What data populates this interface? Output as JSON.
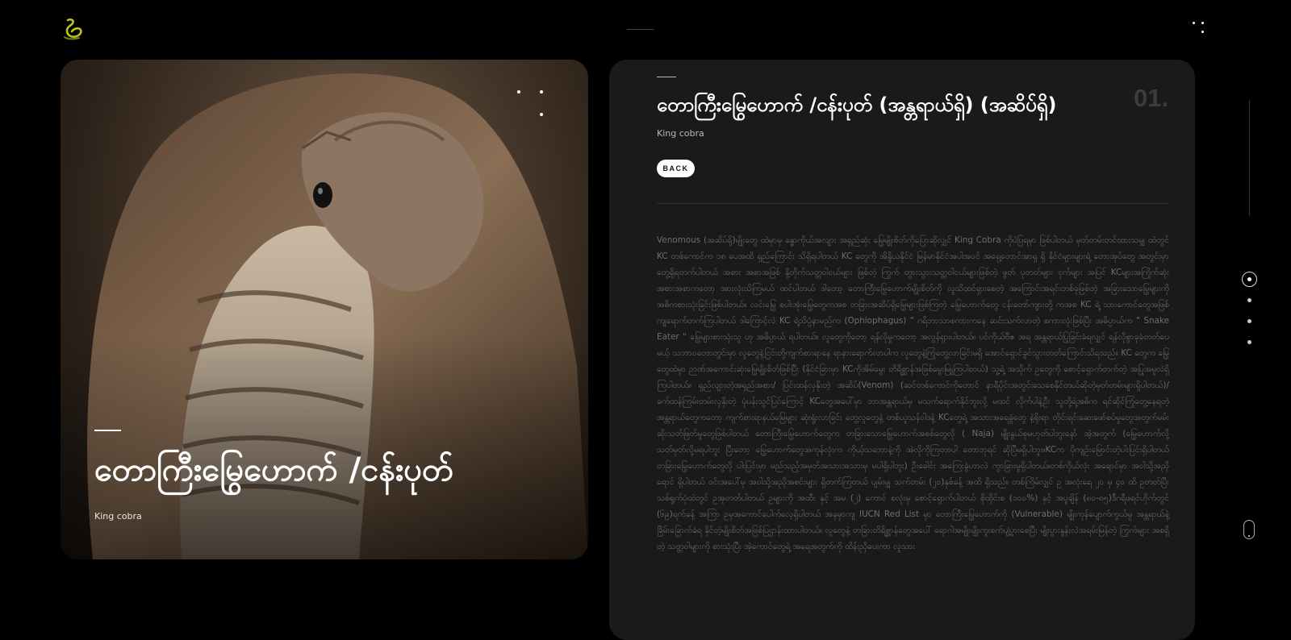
{
  "header": {
    "logo_icon": "cobra-logo-icon",
    "menu_icon": "dots-menu-icon"
  },
  "hero": {
    "title": "တောကြီးမြွေဟောက် /ငန်းပုတ်",
    "subtitle": "King cobra",
    "image": "king-cobra-photo"
  },
  "detail": {
    "title": "တောကြီးမြွေဟောက် /ငန်းပုတ် (အန္တရာယ်ရှိ) (အဆိပ်ရှိ)",
    "subtitle": "King cobra",
    "number": "01.",
    "back_label": "BACK",
    "body": "Venomous (အဆိပ်ရှိ)မျိုးတွေ ထဲမှာမှ ခန္ဓာကိုယ်အလျား အရှည်ဆုံး မြွေမျိုးစိတ်ကိုပြောဆိုလျှင် King Cobra ကိုပဲပြရမှာ ဖြစ်ပါတယ် မှတ်တမ်းတင်ထားသမျှ ထဲတွင် KC တစ်ကောင်က ၁၈ ပေအထိ ရှည်ကြောင်း သိရှိရပါတယ် KC တွေကို အိန္ဒိယနိုင်ငံ မြန်မာနိုင်ငံအပါအဝင် အရှေ့တောင်အာရှ ရှိ နိုင်ငံများများရဲ့ တောအုပ်တွေ အတွင်းမှာ တွေ့ရှိရတက်ပါတယ် အစား အစာအဖြစ် နို့တိုက်သတ္တဝါငယ်များ ဖြစ်တဲ့ ကြွက် တွားသွားသတ္တဝါငယ်များဖြစ်တဲ့ ဖွတ် ပုတတ်များ ငှက်များ အပြင် KCများအကြိုက်ဆုံး အစားအစာကတော့ အားလုံးသိကြမယ် ထင်ပါတယ် ဒါတော့ တောကြီးမြွေဟောက်မျိုးစိတ်ကို လူသိထင်ရှားစေတဲ့ အကြောင်းအရင်းတစ်ခုဖြစ်တဲ့ အခြားသောမြွေများကို အဓိကစားသုံးခြင်းဖြစ်ပါတယ်။ လင်းမြွေ စပါးအုံးမြွေတွေကအစ တခြားအဆိပ်ရှိမြွေများဖြစ်ကြတဲ့ မြွေဟောက်တွေ ငန်းတော်ကျားတို့ ကအစ KC ရဲ့ သားကောင်တွေအဖြစ် ကျရောက်တက်ကြပါတယ် ဒါကြောင့်လဲ KC ရဲ့သိပ္ပံနာမည်က (Ophiophagus) \" ဂရိဘာသာစကားကနေ ဆင်းသက်လာတဲ့ စကားလုံးဖြစ်ပြီး အဓိပ္ပာယ်က \" Snake Eater \" မြွေများစားသုံးသူ ဟု အဓိပ္ပာယ် ရပါတယ်။ လူတွေကိုတော့ ရန်လိုမှုကတော့ အလွန်ရှားပါတယ်။ ပင်ကိုယ်ဗီဇ အရ အန္တရာယ်ပြုခြင်းခံရလျှင် ရန်လိုစွာခုခံတတ်ပေမယ့် သဘာဝတောတွင်းမှာ လူတွေနဲ့ငြင်းတို့ကျက်စားရာနေ ရာနားရောက်လာပါက လူတွေနဲ့ကြုံတွေ့လာခြင်းမရှိ အောင်ရှောင်ခွင်သွားတတ်ကြောင်းသိရသည်။ KC တွေက မြွေတွေထဲမှာ ဉာဏ်အကောင်းဆုံးမြွေမျိုးစိတ်ဖြစ်ပြီး (နိုင်ငံခြားမှာ KCကိုအိမ်မွေး တိရိစ္ဆာန်အဖြစ်မွေးမြူကြပါတယ်) သူ့ရဲ့ အသိုက် ဥတွေကို စောင့်ရှောက်တက်တဲ့ အပြုအမူလဲရှိကြပါတယ်။ ရှည်လျားတဲ့အရှည်အစား/ ပြင်းထန်လှနိုးတဲ့ အဆိပ်(Venom) (ဆင်တစ်ကောင်ကိုတောင် နာရီပိုင်းအတွင်းသေစေနိုင်တယ်ဆိုတဲ့မှတ်တမ်းများရှိပါတယ်)/ ခက်ထန်ကြမ်းတမ်းလှနိုးတဲ့ ပုံပန်းသွင်ပြင်ကြောင့် KCတွေအပေါ်မှာ ဘာအန္တရာယ်မှ မသက်ရောက်နိုင်ဘူးလို့ မထင် လိုက်ပါနဲ့ဦး သူတို့ရဲ့အဓိက ရင်ဆိုင်ကြုံတွေ့နေရတဲ့ အန္တရာယ်တွေကတော့ ကျက်စားရာနယ်မြေများ ဆုံးရှုံးလာခြင်း တွေ့လူတွေနဲ့ တစ်ယူသန်ဝါဒနဲ့ KCတွေရဲ့ အသားအရေခွံတွေ နဲ့ရိုးရာ တိုင်းရင်းဆေးဖော်စပ်မှုတွေအတွက်မမ်းဆိုးသတ်ဖြတ်မှုတွေဖြစ်ပါတယ် တောကြီးမြွေဟောက်တွေက တခြားသောမြွေဟောက်အစစ်တွေလို ( Naja) မျိုးနွယ်စုမဟုတ်ပါဘူးနော် အဲ့အတွက် (မြွေဟောက်လို့ သတ်မှတ်လို့မရပါဘူး ပြီးတော့ မြွေဟောက်တွေအကုန်လုံးက ကိုယ့်သဘောနဲ့ကို အဲလိုကိုကြတာပါ တောဘုရင် ဆိုပြီမရှိပါဘူး။KCက ပိုကျဉ်းမြောင်းတဲ့ပါးပြင်းရှိပါတယ် တခြားမြွေဟောက်တွေလို ပါးပြင်းမှာ မည်သည့်အမှတ်အသားအသားမှ မပါရှိပါဘူး) ဦးခေါင်း အကြေးခွံဟာလဲ ကွာခြားမှုရှိပါတယ်။တစ်ကိုယ်လုံး အရောင်မှာ အဝါသို့အညိုရောင် ရှိပါတယ် ဝင်းအပေါ်မှ အဝါသို့အညိုအစင်းများ ရှိတက်ကြတယ် ပျမ်းမျှ သက်တမ်း (၂၀)နှစ်ခန့် အထိ ရှိသည်။ တစ်ကြိမ်လျှင် ဥ အလုံးရေ ၂၀ မှ ၄၀ ထိ ဥတတ်ပြီး သစ်ရွက်ပုံထဲတွင် ဥအုတတ်ပါတယ် ဥများကို အထီး နှင့် အမ (၂) ကောင် စလုံးမှ စောင့်ရှောက်ပါတယ် စိုထိုင်းစ (၁၀၀%) နှင့် အပူချိန် (၈၀-၈၅)ဒီဂရီဖရင်ဟိုက်တွင် (၆၉)ရက်ခန့် အကြာ ဥမှအကောင်ပေါက်လေ့ရှိပါတယ် အခုမှာကျ IUCN Red List မှာ တောကြီးမြွေဟောက်ကို (Vulnerable) မျိုးကုန်ပျောက်ကွယ်မှု အန္တရာယ်နဲ့ခြိမ်းခြောက်ခံရ နိုင်တဲ့မျိုးစိတ်အဖြစ်ပြဌာန်းထားပါတယ်။ လူတွေနဲ့ တခြားတိရိစ္ဆာန်တွေအပေါ် ရောဂါအမျိုးမျိုးကူးစက်ပျံ့ပွားစေပြီး မျိုးပွားနှုန်းလဲအရမ်းမြန်တဲ့ ကြွက်များ အစရှိတဲ့ သတ္တဝါများကို စားသုံးပြီး အဲ့ကောင်တွေရဲ့ အရေအတွက်ကို ထိန်းညှိပေးကာ လူသား"
  },
  "colors": {
    "background": "#000000",
    "panel": "#1a1a1a",
    "text_muted": "#6e6e6e",
    "logo_accent": "#b9c414"
  },
  "side_nav": {
    "active_index": 0,
    "count": 4,
    "scroll_icon": "mouse-scroll-icon"
  }
}
